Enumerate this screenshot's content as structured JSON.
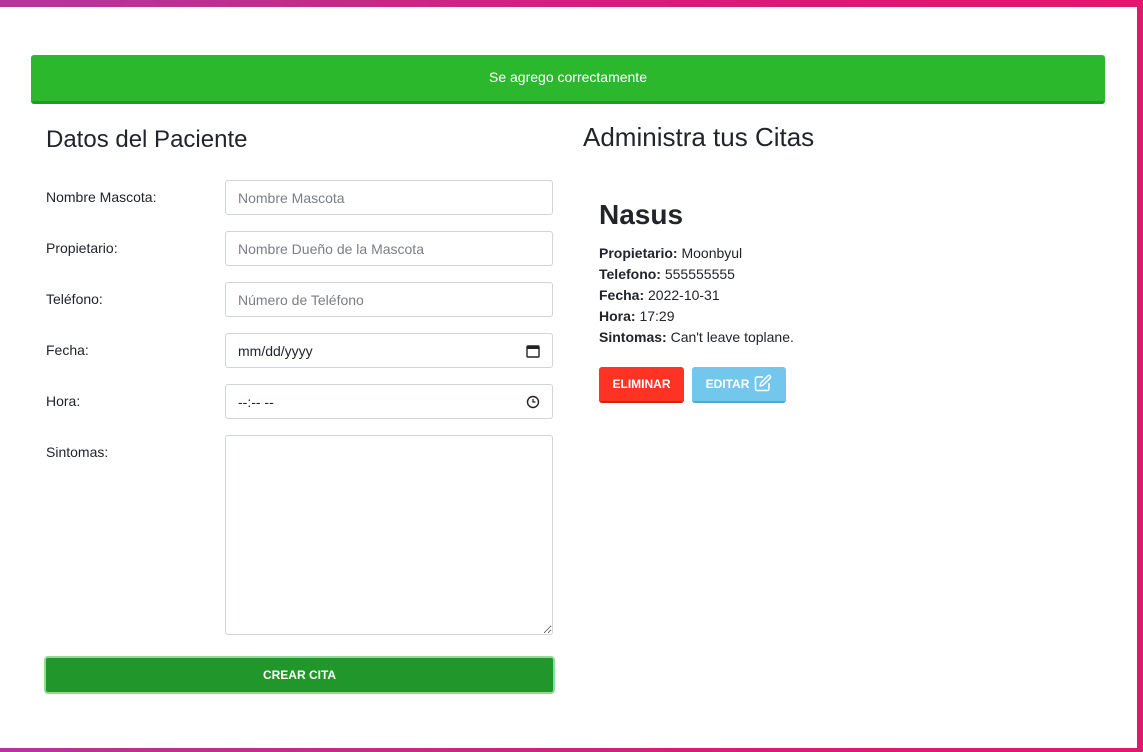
{
  "alert": {
    "message": "Se agrego correctamente",
    "color": "#2bb82d"
  },
  "form": {
    "title": "Datos del Paciente",
    "fields": {
      "mascota": {
        "label": "Nombre Mascota:",
        "placeholder": "Nombre Mascota",
        "value": ""
      },
      "propietario": {
        "label": "Propietario:",
        "placeholder": "Nombre Dueño de la Mascota",
        "value": ""
      },
      "telefono": {
        "label": "Teléfono:",
        "placeholder": "Número de Teléfono",
        "value": ""
      },
      "fecha": {
        "label": "Fecha:",
        "display": "mm/dd/yyyy",
        "icon": "calendar-icon"
      },
      "hora": {
        "label": "Hora:",
        "display": "--:-- --",
        "icon": "clock-icon"
      },
      "sintomas": {
        "label": "Sintomas:",
        "value": ""
      }
    },
    "submit_label": "Crear Cita",
    "submit_color": "#21962a"
  },
  "citas": {
    "title": "Administra tus Citas",
    "items": [
      {
        "mascota": "Nasus",
        "propietario_label": "Propietario:",
        "propietario": "Moonbyul",
        "telefono_label": "Telefono:",
        "telefono": "555555555",
        "fecha_label": "Fecha:",
        "fecha": "2022-10-31",
        "hora_label": "Hora:",
        "hora": "17:29",
        "sintomas_label": "Sintomas:",
        "sintomas": "Can't leave toplane.",
        "eliminar_label": "ELIMINAR",
        "editar_label": "EDITAR",
        "editar_icon": "edit-icon"
      }
    ]
  },
  "colors": {
    "danger": "#ff3324",
    "info": "#74c7ec",
    "border_gradient_start": "#b7359a",
    "border_gradient_end": "#e0186e"
  }
}
